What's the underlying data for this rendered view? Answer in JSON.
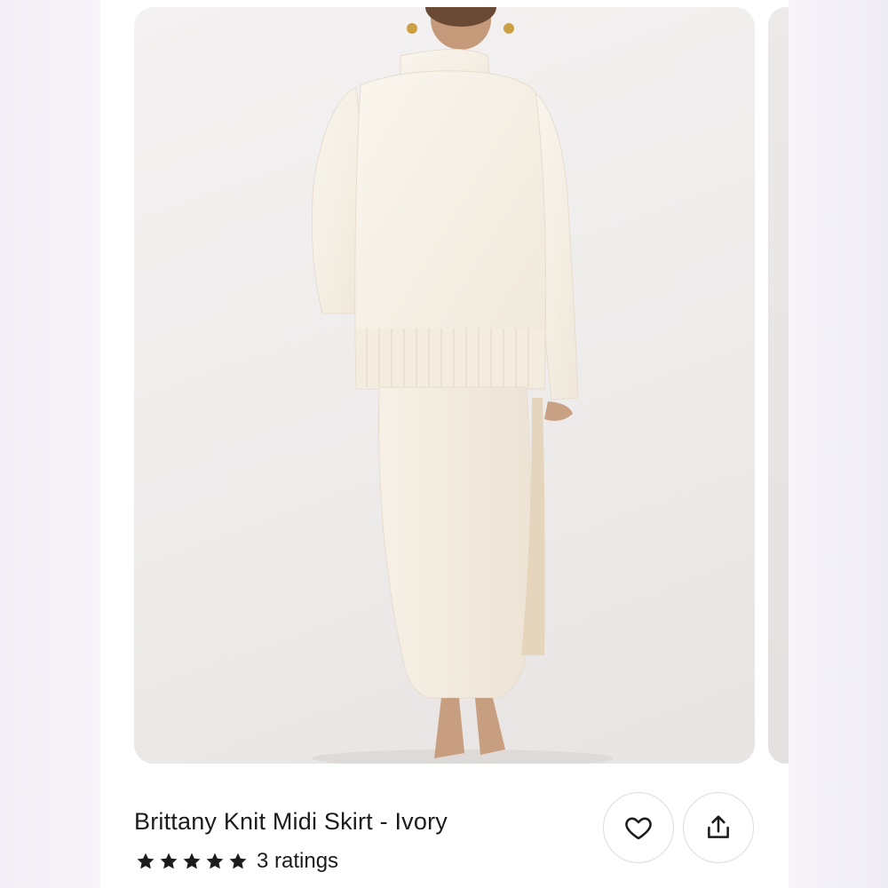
{
  "product": {
    "title": "Brittany Knit Midi Skirt - Ivory",
    "rating": {
      "stars": 5,
      "label": "3 ratings"
    }
  },
  "actions": [
    {
      "name": "favorite",
      "icon": "heart-icon"
    },
    {
      "name": "share",
      "icon": "share-icon"
    }
  ],
  "image": {
    "subject": "model-ivory-knit-set"
  },
  "colors": {
    "text": "#1b1b1b",
    "border": "#dcdcdc",
    "garment": "#f5efe4"
  }
}
